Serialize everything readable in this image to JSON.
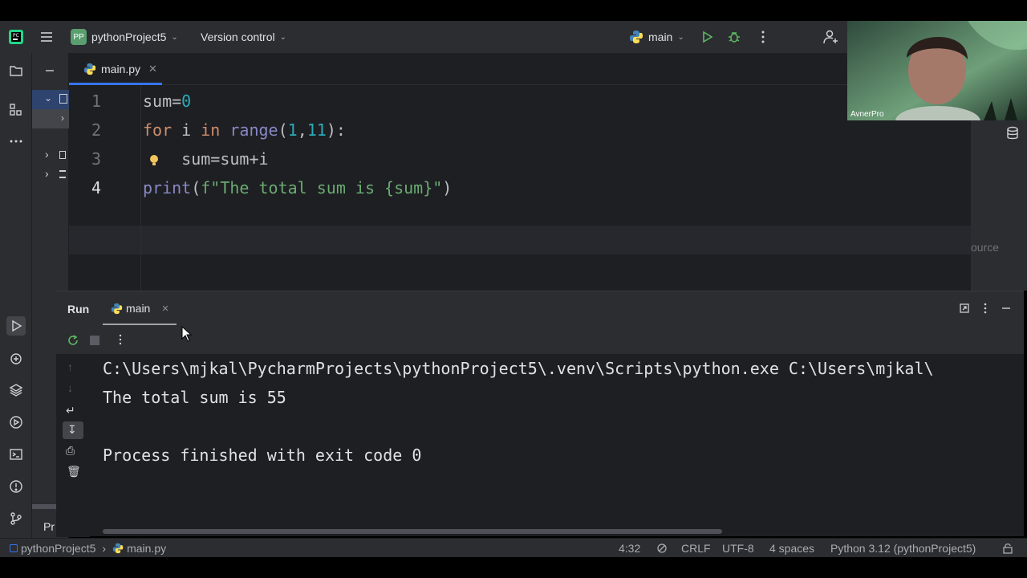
{
  "toolbar": {
    "project_badge": "PP",
    "project_name": "pythonProject5",
    "version_control": "Version control",
    "run_config": "main"
  },
  "editor": {
    "tab_label": "main.py",
    "line_numbers": [
      "1",
      "2",
      "3",
      "4"
    ],
    "lines": [
      {
        "code": "sum=0"
      },
      {
        "code": "for i in range(1,11):"
      },
      {
        "code": "    sum=sum+i"
      },
      {
        "code": "print(f\"The total sum is {sum}\")"
      }
    ],
    "side_hint": "ource"
  },
  "run_panel": {
    "title": "Run",
    "tab_label": "main",
    "output": [
      "C:\\Users\\mjkal\\PycharmProjects\\pythonProject5\\.venv\\Scripts\\python.exe C:\\Users\\mjkal\\",
      "The total sum is 55",
      "",
      "Process finished with exit code 0"
    ]
  },
  "project_panel": {
    "label_fragment": "Pr"
  },
  "statusbar": {
    "breadcrumb_project": "pythonProject5",
    "breadcrumb_file": "main.py",
    "position": "4:32",
    "line_separator": "CRLF",
    "encoding": "UTF-8",
    "indent": "4 spaces",
    "interpreter": "Python 3.12 (pythonProject5)"
  },
  "webcam": {
    "name_label": "AvnerPro"
  },
  "colors": {
    "accent": "#3574f0",
    "keyword": "#cf8e6d",
    "number": "#2aacb8",
    "string": "#6aab73",
    "builtin": "#8888c6",
    "run_green": "#5fb865"
  },
  "icons": [
    "pycharm-logo-icon",
    "hamburger-menu-icon",
    "python-icon",
    "run-icon",
    "debug-icon",
    "more-icon",
    "add-user-icon",
    "folder-icon",
    "structure-icon",
    "rerun-icon",
    "stop-icon",
    "database-icon",
    "settings-icon",
    "git-icon"
  ]
}
